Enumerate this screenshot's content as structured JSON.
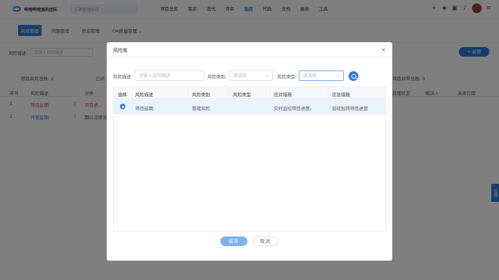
{
  "app": {
    "team_name": "哔哩哔哩测的团队",
    "project_placeholder": "车辆管理系统"
  },
  "nav": {
    "items": [
      "项目总览",
      "需求",
      "迭代",
      "评审",
      "监控",
      "代码",
      "文档",
      "报表",
      "工具"
    ],
    "active_index": 4
  },
  "subtabs": {
    "items": [
      "风险管理",
      "问题管理",
      "机会管理",
      "OA质量管理 ⌄"
    ],
    "active_index": 0
  },
  "background": {
    "filter_label": "风险描述:",
    "filter_placeholder": "请输入风险描述",
    "add_label": "+ 新增",
    "stats": {
      "total": "项目风险总数: 2",
      "identified": "已识",
      "closed": "项目异常总数: 0"
    },
    "table_headers": [
      "序号",
      "风险描述",
      "分类",
      "处理状态",
      "解决人",
      "关闭日期"
    ],
    "rows": [
      {
        "index": "1",
        "desc": "项目延期",
        "sep": "|",
        "category": "项目进..."
      },
      {
        "index": "2",
        "desc": "开发延期",
        "sep": "|",
        "category": "期以法律关..."
      }
    ],
    "side_tab": "反馈"
  },
  "modal": {
    "title": "风险库",
    "close": "×",
    "filters": {
      "desc_label": "风险描述:",
      "desc_placeholder": "请输入风险描述",
      "category_label": "风险类别:",
      "category_placeholder": "请选择",
      "type_label": "风险类型:",
      "type_placeholder": "请选择"
    },
    "table": {
      "headers": [
        "选择",
        "风险描述",
        "风险类别",
        "风险类型",
        "应对措施",
        "应急措施"
      ],
      "rows": [
        {
          "desc": "项目延期",
          "category": "管理风险",
          "type": "",
          "response": "实时监控项目进度。",
          "emergency": "加班加快项目进度"
        }
      ]
    },
    "save_label": "保存",
    "cancel_label": "取消"
  },
  "colors": {
    "primary": "#2f7bd8",
    "selected_row": "#eaf3fd",
    "overlay": "rgba(0,0,0,0.5)"
  }
}
